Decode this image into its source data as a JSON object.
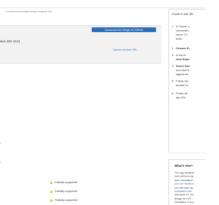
{
  "url_text": "...com/windows/bridge/ios/app-analyzer-tool",
  "bridge_button": "Download the bridge on GitHub",
  "version_text": "sion iOS 10.0)",
  "upload_link": "Upload another IPA",
  "right_panel": {
    "intro": "Xcode to use the",
    "steps": [
      {
        "num": "1.",
        "lines": [
          "In Xcode, c",
          "connected",
          "menu. Fo",
          "build."
        ]
      },
      {
        "num": "2.",
        "lines": [
          "Choose Pr"
        ]
      },
      {
        "num": "3.",
        "lines": [
          "In the Ar",
          "click Expo"
        ]
      },
      {
        "num": "4.",
        "lines": [
          "Select Sav",
          "and click N",
          "signed wit"
        ]
      },
      {
        "num": "5.",
        "lines": [
          "Follow the",
          "another fo"
        ]
      },
      {
        "num": "6.",
        "lines": [
          "Finder wil",
          "app IPA."
        ]
      }
    ]
  },
  "whats_new": {
    "title": "What's new?",
    "lines": [
      "The app analysis",
      "how well your ap",
      "been actually im",
      "you can downloa",
      "out with your ap",
      "evaluation virtu",
      "Windows 10. Vis",
      "Bridge for iOS –",
      "VirtualBox. If you"
    ]
  },
  "left_fragments": [
    "l",
    "l"
  ],
  "support_rows": [
    "Partially supported",
    "Partially supported",
    "Partially supported"
  ],
  "colors": {
    "accent": "#2f6fba",
    "warning": "#e0b400",
    "panel": "#f2f2f2"
  }
}
